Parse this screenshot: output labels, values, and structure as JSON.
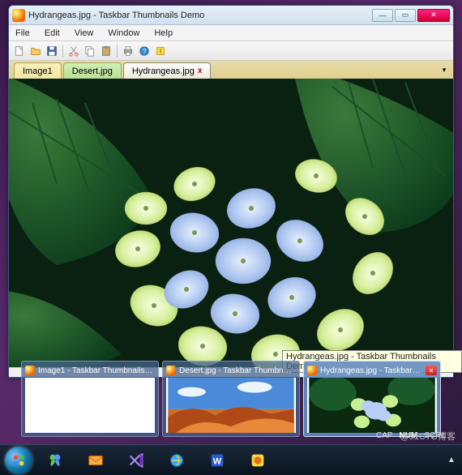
{
  "window": {
    "title": "Hydrangeas.jpg - Taskbar Thumbnails Demo",
    "minimize": "—",
    "maximize": "▭",
    "close": "✕"
  },
  "menu": {
    "file": "File",
    "edit": "Edit",
    "view": "View",
    "window": "Window",
    "help": "Help"
  },
  "tabs": {
    "t1": "Image1",
    "t2": "Desert.jpg",
    "t3": "Hydrangeas.jpg",
    "close_glyph": "x",
    "dropdown": "▾"
  },
  "tooltip": {
    "text": "Hydrangeas.jpg - Taskbar Thumbnails Demo"
  },
  "thumbnails": [
    {
      "title": "Image1 - Taskbar Thumbnails D...",
      "active": false,
      "image": "blank"
    },
    {
      "title": "Desert.jpg - Taskbar Thumbnail...",
      "active": false,
      "image": "desert"
    },
    {
      "title": "Hydrangeas.jpg - Taskbar T...",
      "active": true,
      "image": "hydrangea",
      "closable": true,
      "close": "✕"
    }
  ],
  "status": {
    "cap": "CAP",
    "num": "NUM",
    "scrl": "SCRL"
  },
  "watermark": "@51CTO博客"
}
